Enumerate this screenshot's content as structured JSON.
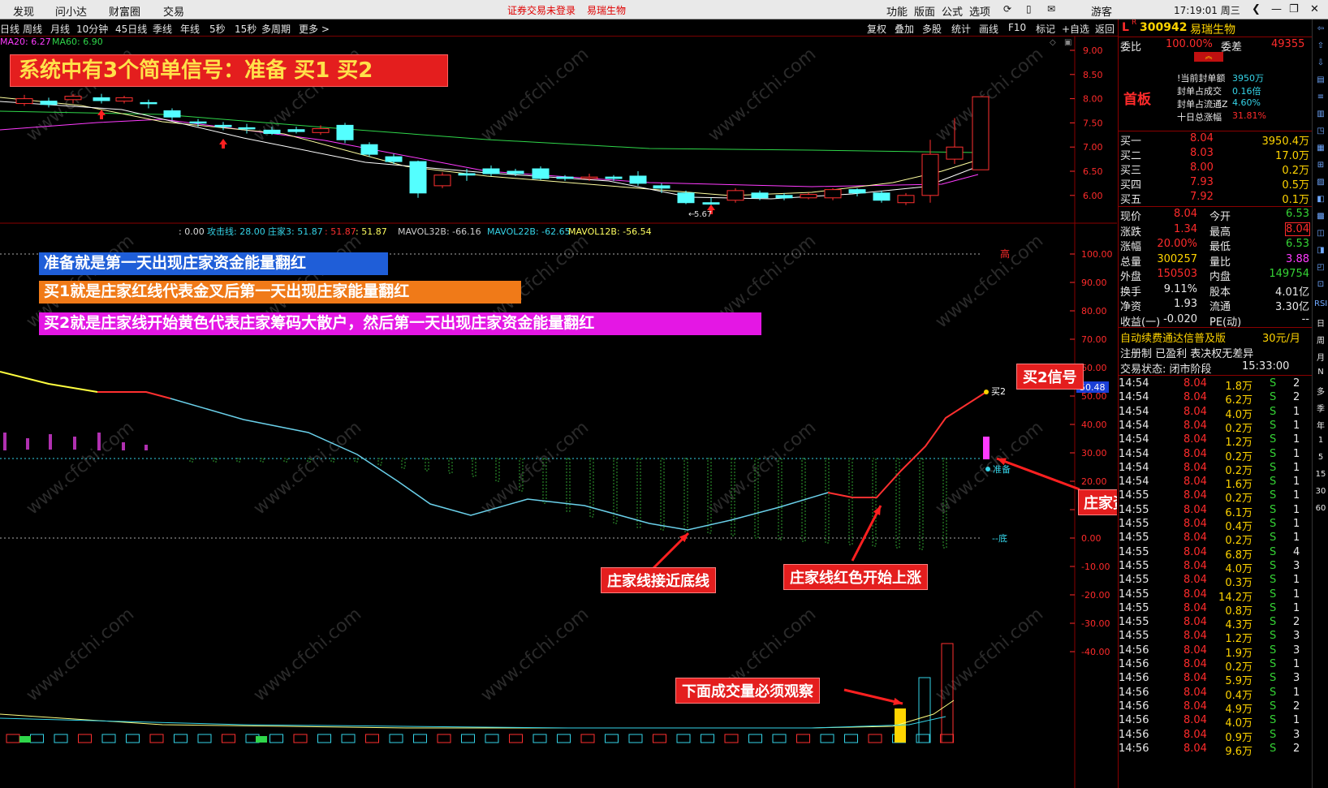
{
  "menu": {
    "items": [
      "发现",
      "问小达",
      "财富圈",
      "交易"
    ],
    "notice_login": "证券交易未登录",
    "notice_stock": "易瑞生物",
    "right": [
      "功能",
      "版面",
      "公式",
      "选项"
    ],
    "guest": "游客",
    "clock": "17:19:01 周三"
  },
  "toolbar": {
    "periods": [
      "日线",
      "周线",
      "月线",
      "10分钟",
      "45日线",
      "季线",
      "年线",
      "5秒",
      "15秒",
      "多周期",
      "更多 >"
    ],
    "actions": [
      "复权",
      "叠加",
      "多股",
      "统计",
      "画线",
      "F10",
      "标记",
      "+自选",
      "返回"
    ]
  },
  "chart": {
    "ma_legend": {
      "ma20": "MA20: 6.27",
      "ma60": "MA60: 6.90"
    },
    "price_axis": [
      "9.00",
      "8.50",
      "8.00",
      "7.50",
      "7.00",
      "6.50",
      "6.00"
    ],
    "low_marker": "5.67",
    "indicator_legend": [
      ": 0.00",
      "攻击线: 28.00",
      "庄家3: 51.87",
      ": 51.87",
      ": 51.87",
      "MAVOL32B: -66.16",
      "MAVOL22B: -62.65",
      "MAVOL12B: -56.54"
    ],
    "indicator_axis": [
      "100.00",
      "90.00",
      "80.00",
      "70.00",
      "60.00",
      "50.00",
      "40.00",
      "30.00",
      "20.00",
      "10.00",
      "0.00",
      "-10.00",
      "-20.00",
      "-30.00",
      "-40.00"
    ],
    "current_value": "50.48",
    "labels": {
      "high": "高",
      "low": "底",
      "buy2": "买2",
      "prepare": "准备"
    },
    "title_banner": "系统中有3个简单信号：准备 买1 买2",
    "explain": [
      "准备就是第一天出现庄家资金能量翻红",
      "买1就是庄家红线代表金叉后第一天出现庄家能量翻红",
      "买2就是庄家线开始黄色代表庄家筹码大散户，然后第一天出现庄家资金能量翻红"
    ],
    "callouts": {
      "buy2_signal": "买2信号",
      "energy_red": "庄家资金能量翻红",
      "near_bottom": "庄家线接近底线",
      "red_rising": "庄家线红色开始上涨",
      "volume_watch": "下面成交量必须观察"
    }
  },
  "quote": {
    "code": "300942",
    "name": "易瑞生物",
    "flag_l": "L",
    "flag_r": "R",
    "weibi_label": "委比",
    "weibi": "100.00%",
    "weicha_label": "委差",
    "weicha": "49355",
    "first_board": "首板",
    "seal": [
      {
        "label": "!当前封单额",
        "value": "3950万"
      },
      {
        "label": "封单占成交",
        "value": "0.16倍"
      },
      {
        "label": "封单占流通Z",
        "value": "4.60%"
      },
      {
        "label": "十日总涨幅",
        "value": "31.81%"
      }
    ],
    "bids": [
      {
        "label": "买一",
        "price": "8.04",
        "vol": "3950.4万"
      },
      {
        "label": "买二",
        "price": "8.03",
        "vol": "17.0万"
      },
      {
        "label": "买三",
        "price": "8.00",
        "vol": "0.2万"
      },
      {
        "label": "买四",
        "price": "7.93",
        "vol": "0.5万"
      },
      {
        "label": "买五",
        "price": "7.92",
        "vol": "0.1万"
      }
    ],
    "stats": [
      {
        "l1": "现价",
        "v1": "8.04",
        "l2": "今开",
        "v2": "6.53",
        "c1": "red",
        "c2": "grn"
      },
      {
        "l1": "涨跌",
        "v1": "1.34",
        "l2": "最高",
        "v2": "8.04",
        "c1": "red",
        "c2": "red"
      },
      {
        "l1": "涨幅",
        "v1": "20.00%",
        "l2": "最低",
        "v2": "6.53",
        "c1": "red",
        "c2": "grn"
      },
      {
        "l1": "总量",
        "v1": "300257",
        "l2": "量比",
        "v2": "3.88",
        "c1": "yel",
        "c2": "mag"
      },
      {
        "l1": "外盘",
        "v1": "150503",
        "l2": "内盘",
        "v2": "149754",
        "c1": "red",
        "c2": "grn"
      },
      {
        "l1": "换手",
        "v1": "9.11%",
        "l2": "股本",
        "v2": "4.01亿",
        "c1": "wht",
        "c2": "wht"
      },
      {
        "l1": "净资",
        "v1": "1.93",
        "l2": "流通",
        "v2": "3.30亿",
        "c1": "wht",
        "c2": "wht"
      },
      {
        "l1": "收益(一)",
        "v1": "-0.020",
        "l2": "PE(动)",
        "v2": "--",
        "c1": "wht",
        "c2": "wht"
      }
    ],
    "promo": "自动续费通达信普及版",
    "promo_price": "30元/月",
    "reg_info": "注册制 已盈利 表决权无差异",
    "trade_status_label": "交易状态: 闭市阶段",
    "trade_status_time": "15:33:00",
    "ticks": [
      {
        "t": "14:54",
        "p": "8.04",
        "v": "1.8万",
        "s": "S",
        "n": "2"
      },
      {
        "t": "14:54",
        "p": "8.04",
        "v": "6.2万",
        "s": "S",
        "n": "2"
      },
      {
        "t": "14:54",
        "p": "8.04",
        "v": "4.0万",
        "s": "S",
        "n": "1"
      },
      {
        "t": "14:54",
        "p": "8.04",
        "v": "0.2万",
        "s": "S",
        "n": "1"
      },
      {
        "t": "14:54",
        "p": "8.04",
        "v": "1.2万",
        "s": "S",
        "n": "1"
      },
      {
        "t": "14:54",
        "p": "8.04",
        "v": "0.2万",
        "s": "S",
        "n": "1"
      },
      {
        "t": "14:54",
        "p": "8.04",
        "v": "0.2万",
        "s": "S",
        "n": "1"
      },
      {
        "t": "14:54",
        "p": "8.04",
        "v": "1.6万",
        "s": "S",
        "n": "1"
      },
      {
        "t": "14:55",
        "p": "8.04",
        "v": "0.2万",
        "s": "S",
        "n": "1"
      },
      {
        "t": "14:55",
        "p": "8.04",
        "v": "6.1万",
        "s": "S",
        "n": "1"
      },
      {
        "t": "14:55",
        "p": "8.04",
        "v": "0.4万",
        "s": "S",
        "n": "1"
      },
      {
        "t": "14:55",
        "p": "8.04",
        "v": "0.2万",
        "s": "S",
        "n": "1"
      },
      {
        "t": "14:55",
        "p": "8.04",
        "v": "6.8万",
        "s": "S",
        "n": "4"
      },
      {
        "t": "14:55",
        "p": "8.04",
        "v": "4.0万",
        "s": "S",
        "n": "3"
      },
      {
        "t": "14:55",
        "p": "8.04",
        "v": "0.3万",
        "s": "S",
        "n": "1"
      },
      {
        "t": "14:55",
        "p": "8.04",
        "v": "14.2万",
        "s": "S",
        "n": "1"
      },
      {
        "t": "14:55",
        "p": "8.04",
        "v": "0.8万",
        "s": "S",
        "n": "1"
      },
      {
        "t": "14:55",
        "p": "8.04",
        "v": "4.3万",
        "s": "S",
        "n": "2"
      },
      {
        "t": "14:55",
        "p": "8.04",
        "v": "1.2万",
        "s": "S",
        "n": "3"
      },
      {
        "t": "14:56",
        "p": "8.04",
        "v": "1.9万",
        "s": "S",
        "n": "3"
      },
      {
        "t": "14:56",
        "p": "8.04",
        "v": "0.2万",
        "s": "S",
        "n": "1"
      },
      {
        "t": "14:56",
        "p": "8.04",
        "v": "5.9万",
        "s": "S",
        "n": "3"
      },
      {
        "t": "14:56",
        "p": "8.04",
        "v": "0.4万",
        "s": "S",
        "n": "1"
      },
      {
        "t": "14:56",
        "p": "8.04",
        "v": "4.9万",
        "s": "S",
        "n": "2"
      },
      {
        "t": "14:56",
        "p": "8.04",
        "v": "4.0万",
        "s": "S",
        "n": "1"
      },
      {
        "t": "14:56",
        "p": "8.04",
        "v": "0.9万",
        "s": "S",
        "n": "3"
      },
      {
        "t": "14:56",
        "p": "8.04",
        "v": "9.6万",
        "s": "S",
        "n": "2"
      }
    ]
  },
  "iconbar": [
    "RSI",
    "日",
    "周",
    "月",
    "N",
    "多",
    "季",
    "年",
    "1",
    "5",
    "15",
    "30",
    "60"
  ],
  "watermark": "www.cfchi.com"
}
